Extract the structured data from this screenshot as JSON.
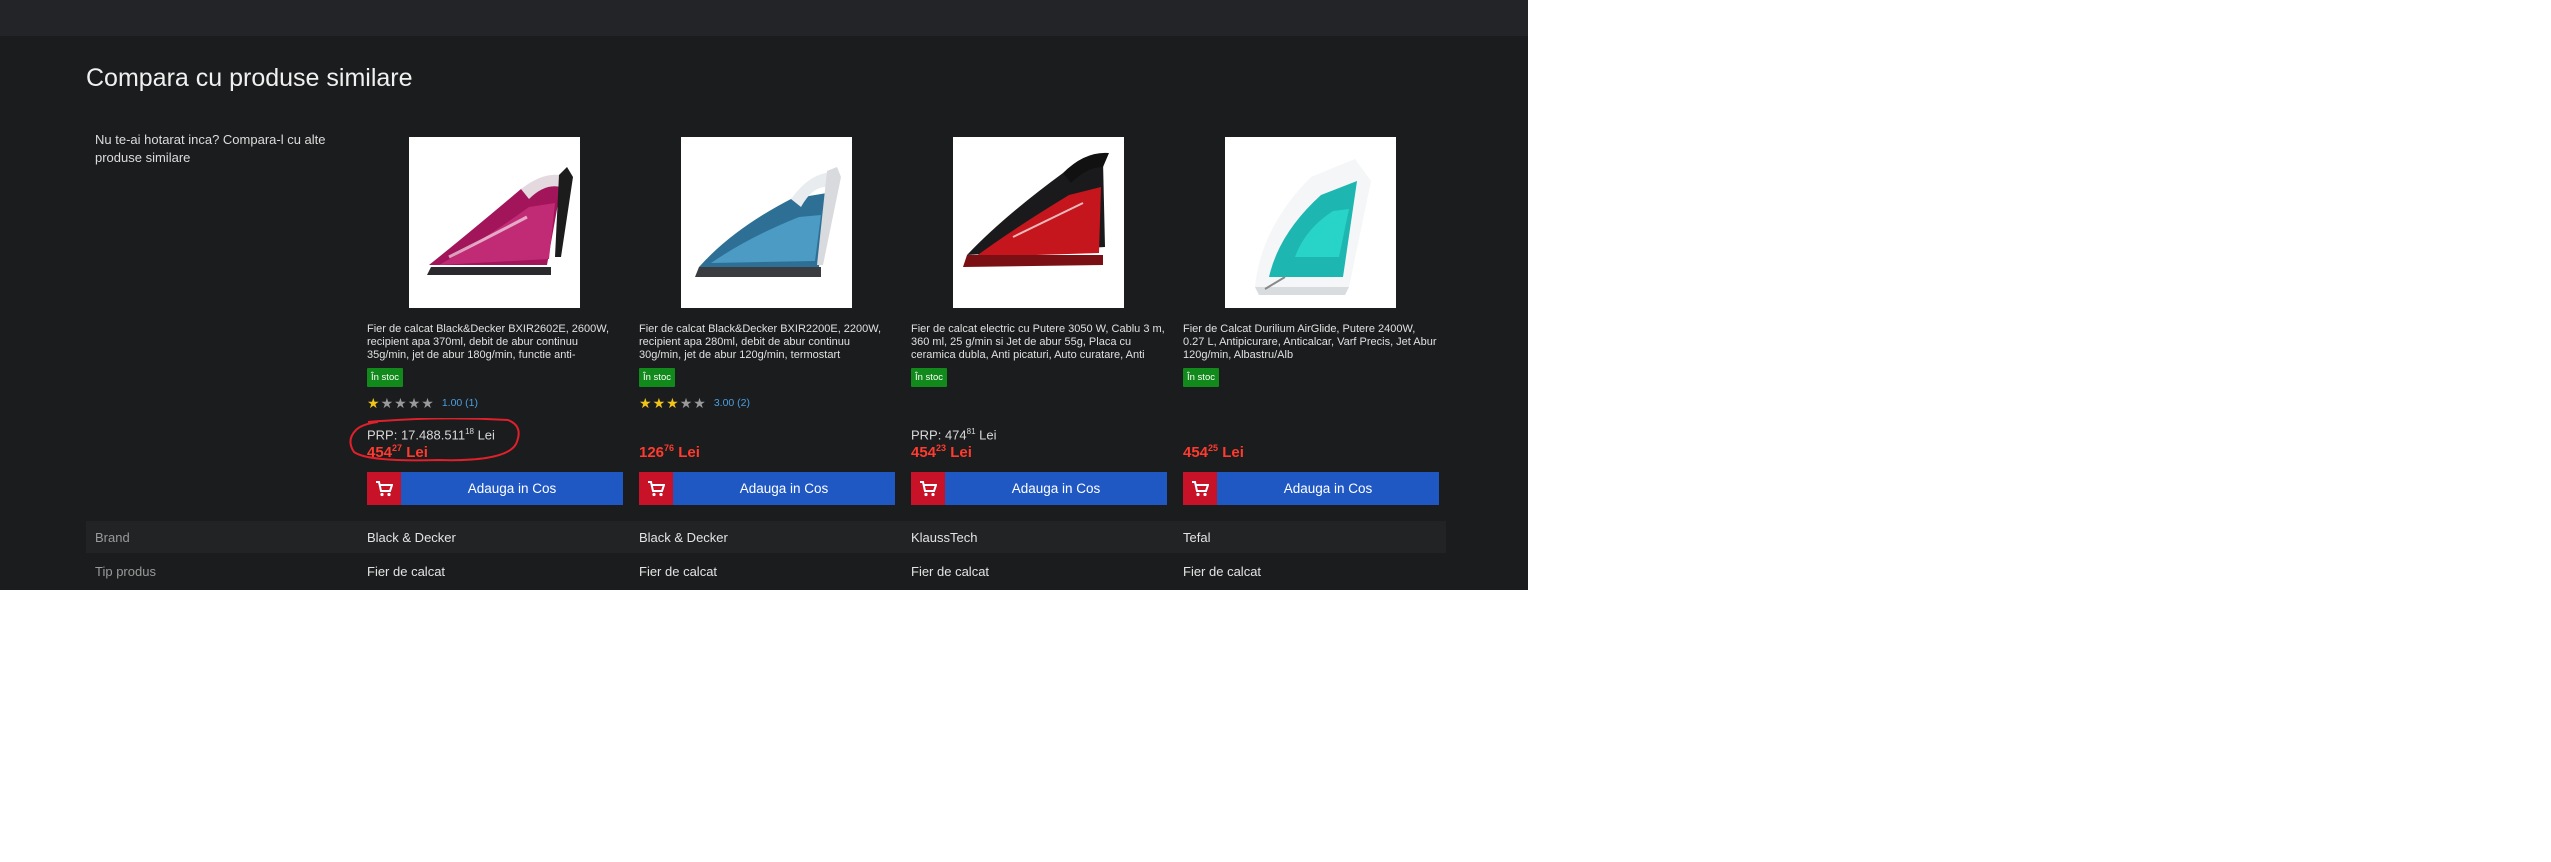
{
  "section": {
    "title": "Compara cu produse similare",
    "intro": "Nu te-ai hotarat inca? Compara-l cu alte produse similare"
  },
  "products": [
    {
      "name": "Fier de calcat Black&Decker BXIR2602E, 2600W, recipient apa 370ml, debit de abur continuu 35g/min, jet de abur 180g/min, functie anti-",
      "stock": "În stoc",
      "stars": 1,
      "rating_text": "1.00 (1)",
      "prp_label": "PRP: 17.488.511",
      "prp_sup": "18",
      "prp_unit": " Lei",
      "price_int": "454",
      "price_dec": "27",
      "price_unit": " Lei",
      "button": "Adauga in Cos"
    },
    {
      "name": "Fier de calcat Black&Decker BXIR2200E, 2200W, recipient apa 280ml, debit de abur continuu 30g/min, jet de abur 120g/min, termostart",
      "stock": "În stoc",
      "stars": 3,
      "rating_text": "3.00 (2)",
      "prp_label": "",
      "prp_sup": "",
      "prp_unit": "",
      "price_int": "126",
      "price_dec": "76",
      "price_unit": " Lei",
      "button": "Adauga in Cos"
    },
    {
      "name": "Fier de calcat electric cu Putere 3050 W, Cablu 3 m, 360 ml, 25 g/min si Jet de abur 55g, Placa cu ceramica dubla, Anti picaturi, Auto curatare, Anti",
      "stock": "În stoc",
      "stars": 0,
      "rating_text": "",
      "prp_label": "PRP: 474",
      "prp_sup": "81",
      "prp_unit": " Lei",
      "price_int": "454",
      "price_dec": "23",
      "price_unit": " Lei",
      "button": "Adauga in Cos"
    },
    {
      "name": "Fier de Calcat Durilium AirGlide, Putere 2400W, 0.27 L, Antipicurare, Anticalcar, Varf Precis, Jet Abur 120g/min, Albastru/Alb",
      "stock": "În stoc",
      "stars": 0,
      "rating_text": "",
      "prp_label": "",
      "prp_sup": "",
      "prp_unit": "",
      "price_int": "454",
      "price_dec": "25",
      "price_unit": " Lei",
      "button": "Adauga in Cos"
    }
  ],
  "attributes": [
    {
      "label": "Brand",
      "values": [
        "Black & Decker",
        "Black & Decker",
        "KlaussTech",
        "Tefal"
      ]
    },
    {
      "label": "Tip produs",
      "values": [
        "Fier de calcat",
        "Fier de calcat",
        "Fier de calcat",
        "Fier de calcat"
      ]
    }
  ],
  "colors": {
    "background": "#1b1c1e",
    "price": "#ff3b2f",
    "button": "#1f57c3",
    "cart_icon_bg": "#c81228",
    "stock_badge": "#118a1b",
    "star": "#f0c419",
    "rating_link": "#4a9fe0",
    "annotation": "#e0202a"
  },
  "icons": [
    "shopping-cart-icon",
    "star-icon"
  ]
}
